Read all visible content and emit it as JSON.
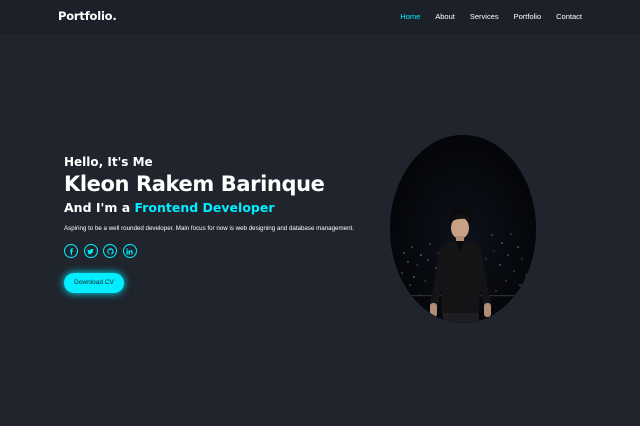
{
  "header": {
    "logo": "Portfolio.",
    "nav": [
      {
        "label": "Home",
        "active": true
      },
      {
        "label": "About",
        "active": false
      },
      {
        "label": "Services",
        "active": false
      },
      {
        "label": "Portfolio",
        "active": false
      },
      {
        "label": "Contact",
        "active": false
      }
    ]
  },
  "home": {
    "greeting": "Hello, It's Me",
    "name": "Kleon Rakem Barinque",
    "role_prefix": "And I'm a ",
    "role_highlight": "Frontend Developer",
    "description": "Aspiring to be a well rounded developer. Main focus for now is web designing and database management.",
    "socials": [
      "facebook-icon",
      "twitter-icon",
      "github-icon",
      "linkedin-icon"
    ],
    "cta_label": "Download CV"
  },
  "colors": {
    "background": "#1f242d",
    "header_background": "#1c2129",
    "accent": "#00eeff",
    "text": "#ffffff"
  }
}
